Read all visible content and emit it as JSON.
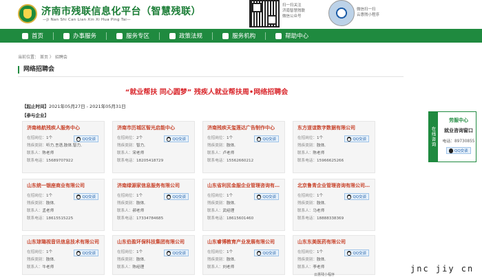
{
  "header": {
    "title": "济南市残联信息化平台",
    "title_suffix": "（智慧残联）",
    "subtitle": "—Ji Nan Shi Can Lian Xin Xi Hua Ping Tai—",
    "qr1_text": [
      "扫一扫关注",
      "济南智慧残联",
      "微信公众号"
    ],
    "qr2_text": [
      "微信扫一扫",
      "云惠残小程序"
    ]
  },
  "nav": {
    "items": [
      {
        "label": "首页",
        "icon": "home-icon"
      },
      {
        "label": "办事服务",
        "icon": "service-icon"
      },
      {
        "label": "服务专区",
        "icon": "zone-icon"
      },
      {
        "label": "政策法规",
        "icon": "policy-icon"
      },
      {
        "label": "服务机构",
        "icon": "org-icon"
      },
      {
        "label": "帮助中心",
        "icon": "help-icon"
      }
    ]
  },
  "breadcrumb": {
    "prefix": "当前位置：",
    "home": "首页",
    "sep": "〉",
    "current": "招聘会"
  },
  "section_title": "网络招聘会",
  "headline": "“就业帮扶 同心圆梦” 残疾人就业帮扶周•网络招聘会",
  "date_label": "【起止时间】",
  "date_value": "2021年05月27日 - 2021年05月31日",
  "participants_label": "【参与企业】",
  "labels": {
    "positions": "在招岗位：",
    "disability": "残疾类别：",
    "contact": "联系人：",
    "phone": "联系电话：",
    "qq": "QQ交谈"
  },
  "companies": [
    {
      "name": "济南格航残疾人服务中心",
      "positions": "1个",
      "disability": "听力,言语,肢体,智力,",
      "contact": "陈老师",
      "phone": "15689707922"
    },
    {
      "name": "济南市历城区智光启能中心",
      "positions": "2个",
      "disability": "智力,",
      "contact": "宋老师",
      "phone": "18205418729"
    },
    {
      "name": "济南残疾天玺莲达广告制作中心",
      "positions": "1个",
      "disability": "肢体,",
      "contact": "卢老师",
      "phone": "15562660212"
    },
    {
      "name": "东方道谊数字数据有限公司",
      "positions": "1个",
      "disability": "肢体,",
      "contact": "陈老师",
      "phone": "15966625266"
    },
    {
      "name": "山东统一银座商业有限公司",
      "positions": "1个",
      "disability": "肢体,",
      "contact": "孟老师",
      "phone": "18615515225"
    },
    {
      "name": "济南绿源家信息服务有限公司",
      "positions": "1个",
      "disability": "肢体,",
      "contact": "郝老师",
      "phone": "17334784685"
    },
    {
      "name": "山东省利民金服企业管理咨询有限公司",
      "positions": "1个",
      "disability": "肢体,",
      "contact": "武经理",
      "phone": "18615601460"
    },
    {
      "name": "北京鲁青企业管理咨询有限公司济南分公司",
      "positions": "1个",
      "disability": "肢体,",
      "contact": "马老师",
      "phone": "18888338369"
    },
    {
      "name": "山东琼璐视音讯信息技术有限公司",
      "positions": "1个",
      "disability": "肢体,",
      "contact": "牛老师",
      "phone": ""
    },
    {
      "name": "山东伯盈环保科技集团有限公司",
      "positions": "1个",
      "disability": "肢体,",
      "contact": "陈经理",
      "phone": ""
    },
    {
      "name": "山东睿博教育产业发展有限公司",
      "positions": "1个",
      "disability": "肢体,",
      "contact": "刘老师",
      "phone": ""
    },
    {
      "name": "山东东美医药有限公司",
      "positions": "1个",
      "disability": "肢体,",
      "contact": "李老师",
      "phone": ""
    }
  ],
  "float_panel": {
    "tab": "在线咨询",
    "title": "劳服中心",
    "subtitle": "就业咨询窗口",
    "phone": "电话：89730855",
    "qq": "QQ交谈"
  },
  "watermark": "jnc jiy cn",
  "bottom_text": "云惠残小程序"
}
